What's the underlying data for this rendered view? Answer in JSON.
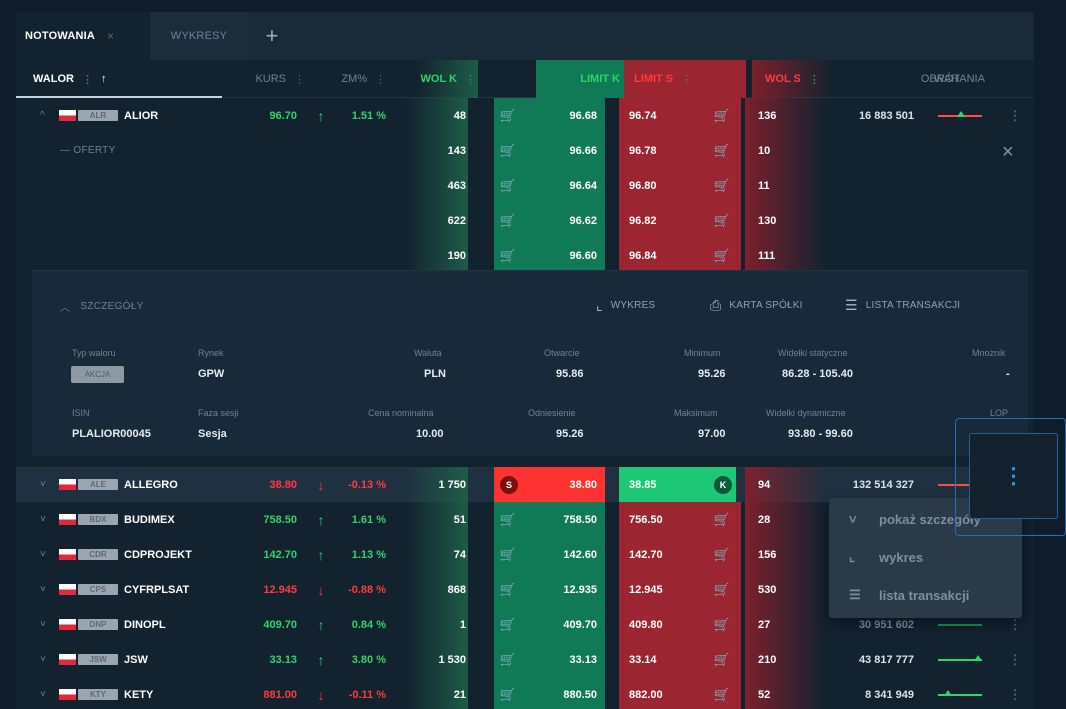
{
  "tabs": [
    {
      "label": "NOTOWANIA",
      "close": "×"
    },
    {
      "label": "WYKRESY"
    },
    {
      "label": "+"
    }
  ],
  "columns": {
    "walor": "WALOR",
    "kurs": "KURS",
    "zm": "ZM%",
    "wolk": "WOL K",
    "limk": "LIMIT K",
    "lims": "LIMIT S",
    "wols": "WOL S",
    "obrot": "OBRÓT",
    "wahania": "WAHANIA",
    "sep": "⋮",
    "sort_icon": "↑"
  },
  "alior": {
    "chev": "^",
    "ticker": "ALR",
    "name": "ALIOR",
    "kurs": "96.70",
    "arrow": "↑",
    "zm": "1.51 %",
    "obrot": "16 883 501",
    "offers_label": "— OFERTY",
    "book": [
      {
        "wolk": "48",
        "limk": "96.68",
        "lims": "96.74",
        "wols": "136"
      },
      {
        "wolk": "143",
        "limk": "96.66",
        "lims": "96.78",
        "wols": "10"
      },
      {
        "wolk": "463",
        "limk": "96.64",
        "lims": "96.80",
        "wols": "11"
      },
      {
        "wolk": "622",
        "limk": "96.62",
        "lims": "96.82",
        "wols": "130"
      },
      {
        "wolk": "190",
        "limk": "96.60",
        "lims": "96.84",
        "wols": "111"
      }
    ]
  },
  "details": {
    "title": "SZCZEGÓŁY",
    "actions": {
      "chart": "WYKRES",
      "card": "KARTA SPÓŁKI",
      "trades": "LISTA TRANSAKCJI"
    },
    "typ_label": "Typ waloru",
    "typ_value": "AKCJA",
    "rynek_label": "Rynek",
    "rynek_value": "GPW",
    "waluta_label": "Waluta",
    "waluta_value": "PLN",
    "otwarcie_label": "Otwarcie",
    "otwarcie_value": "95.86",
    "min_label": "Minimum",
    "min_value": "95.26",
    "wid_stat_label": "Widełki statyczne",
    "wid_stat_value": "86.28 - 105.40",
    "wskaznik_label": "Mnożnik",
    "wskaznik_value": "-",
    "isin_label": "ISIN",
    "isin_value": "PLALIOR00045",
    "faza_label": "Faza sesji",
    "faza_value": "Sesja",
    "nominal_label": "Cena nominalna",
    "nominal_value": "10.00",
    "odniesienie_label": "Odniesienie",
    "odniesienie_value": "95.26",
    "max_label": "Maksimum",
    "max_value": "97.00",
    "wid_dyn_label": "Widełki dynamiczne",
    "wid_dyn_value": "93.80 - 99.60",
    "lop_label": "LOP"
  },
  "rows": [
    {
      "ticker": "ALE",
      "name": "ALLEGRO",
      "kurs": "38.80",
      "arrow": "↓",
      "zm": "-0.13 %",
      "wolk": "1 750",
      "limk": "38.80",
      "lims": "38.85",
      "wols": "94",
      "obrot": "132 514 327",
      "dir": "down"
    },
    {
      "ticker": "BDX",
      "name": "BUDIMEX",
      "kurs": "758.50",
      "arrow": "↑",
      "zm": "1.61 %",
      "wolk": "51",
      "limk": "758.50",
      "lims": "756.50",
      "wols": "28",
      "obrot": "",
      "dir": "up"
    },
    {
      "ticker": "CDR",
      "name": "CDPROJEKT",
      "kurs": "142.70",
      "arrow": "↑",
      "zm": "1.13 %",
      "wolk": "74",
      "limk": "142.60",
      "lims": "142.70",
      "wols": "156",
      "obrot": "",
      "dir": "up"
    },
    {
      "ticker": "CPS",
      "name": "CYFRPLSAT",
      "kurs": "12.945",
      "arrow": "↓",
      "zm": "-0.88 %",
      "wolk": "868",
      "limk": "12.935",
      "lims": "12.945",
      "wols": "530",
      "obrot": "",
      "dir": "down"
    },
    {
      "ticker": "DNP",
      "name": "DINOPL",
      "kurs": "409.70",
      "arrow": "↑",
      "zm": "0.84 %",
      "wolk": "1",
      "limk": "409.70",
      "lims": "409.80",
      "wols": "27",
      "obrot": "30 951 602",
      "dir": "up"
    },
    {
      "ticker": "JSW",
      "name": "JSW",
      "kurs": "33.13",
      "arrow": "↑",
      "zm": "3.80 %",
      "wolk": "1 530",
      "limk": "33.13",
      "lims": "33.14",
      "wols": "210",
      "obrot": "43 817 777",
      "dir": "up"
    },
    {
      "ticker": "KTY",
      "name": "KETY",
      "kurs": "881.00",
      "arrow": "↓",
      "zm": "-0.11 %",
      "wolk": "21",
      "limk": "880.50",
      "lims": "882.00",
      "wols": "52",
      "obrot": "8 341 949",
      "dir": "down"
    }
  ],
  "allegro_badges": {
    "buy": "S",
    "sell": "K"
  },
  "menu": {
    "items": [
      {
        "label": "pokaż szczegóły",
        "icon": "chevron-down-icon"
      },
      {
        "label": "wykres",
        "icon": "chart-icon"
      },
      {
        "label": "lista transakcji",
        "icon": "list-icon"
      }
    ]
  },
  "kebab_glyph": "⋮",
  "colors": {
    "green": "#2fd46a",
    "red": "#ff3b3b",
    "bid": "#0f7a55",
    "ask": "#9b2530"
  }
}
